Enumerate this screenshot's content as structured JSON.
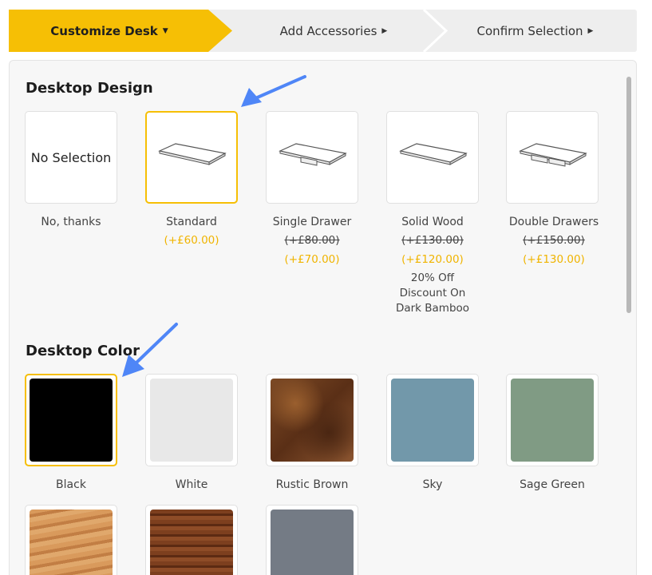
{
  "stepper": {
    "steps": [
      {
        "label": "Customize Desk",
        "caret": "▼"
      },
      {
        "label": "Add Accessories",
        "caret": "▶"
      },
      {
        "label": "Confirm Selection",
        "caret": "▶"
      }
    ]
  },
  "desktop_design": {
    "title": "Desktop Design",
    "no_selection_text": "No Selection",
    "options": [
      {
        "label": "No, thanks",
        "old_price": "",
        "price": "",
        "note": ""
      },
      {
        "label": "Standard",
        "old_price": "",
        "price": "(+£60.00)",
        "note": ""
      },
      {
        "label": "Single Drawer",
        "old_price": "(+£80.00)",
        "price": "(+£70.00)",
        "note": ""
      },
      {
        "label": "Solid Wood",
        "old_price": "(+£130.00)",
        "price": "(+£120.00)",
        "note": "20% Off Discount On Dark Bamboo"
      },
      {
        "label": "Double Drawers",
        "old_price": "(+£150.00)",
        "price": "(+£130.00)",
        "note": ""
      }
    ]
  },
  "desktop_color": {
    "title": "Desktop Color",
    "options": [
      {
        "label": "Black",
        "color": "#000000"
      },
      {
        "label": "White",
        "color": "#e8e8e8"
      },
      {
        "label": "Rustic Brown",
        "color": "#6e3f1f"
      },
      {
        "label": "Sky",
        "color": "#7298aa"
      },
      {
        "label": "Sage Green",
        "color": "#809b84"
      }
    ],
    "more_swatches": [
      {
        "color": "#c98a4d"
      },
      {
        "color": "#7a3e1f"
      },
      {
        "color": "#747b85"
      }
    ]
  },
  "colors": {
    "accent": "#f6bf05",
    "price": "#f0b400",
    "annotation_arrow": "#4f86f7"
  }
}
